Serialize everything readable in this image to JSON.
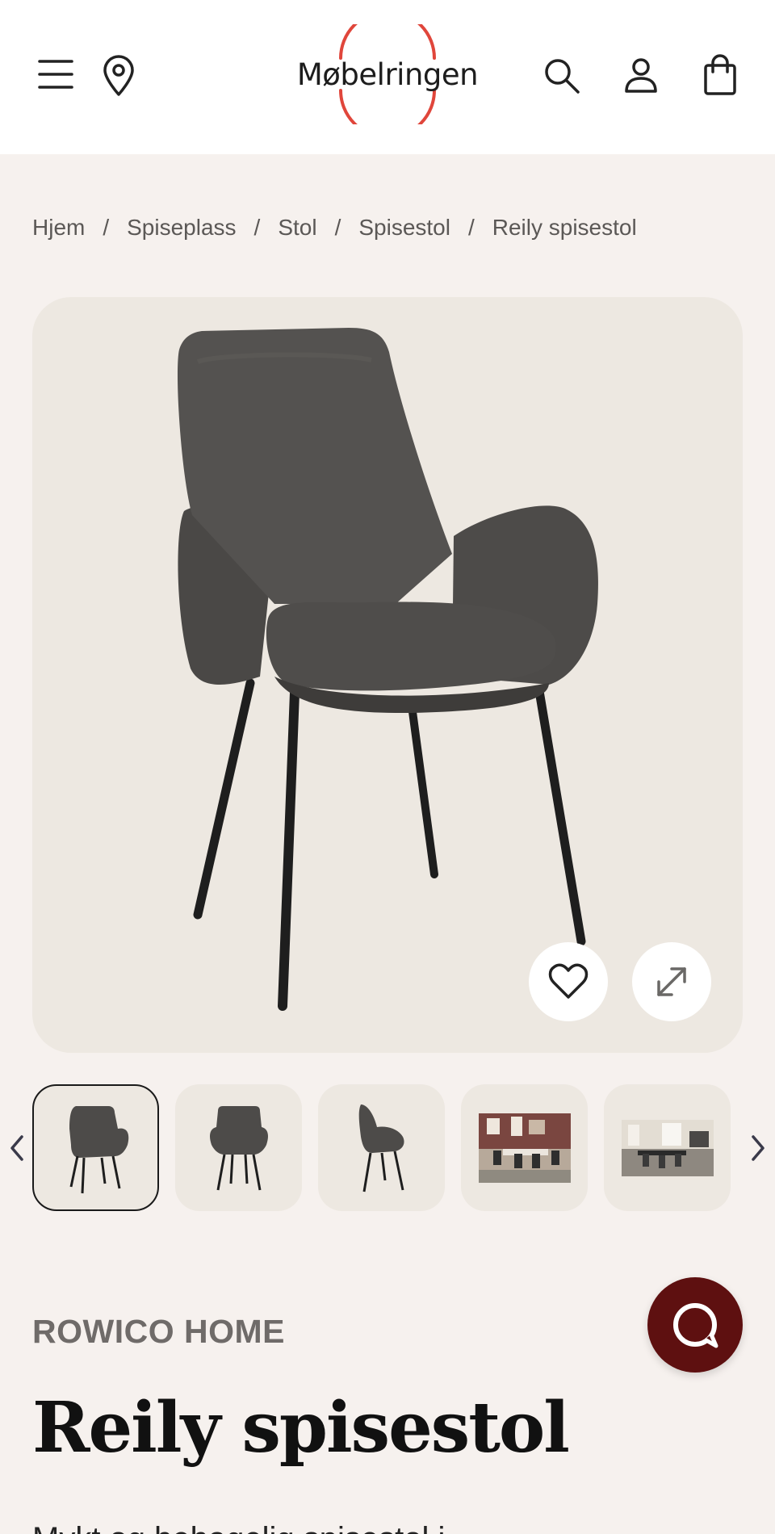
{
  "header": {
    "logo_text": "Møbelringen",
    "icons": [
      "menu-icon",
      "location-pin-icon",
      "search-icon",
      "user-icon",
      "shopping-bag-icon"
    ]
  },
  "breadcrumb": [
    {
      "label": "Hjem"
    },
    {
      "label": "Spiseplass"
    },
    {
      "label": "Stol"
    },
    {
      "label": "Spisestol"
    },
    {
      "label": "Reily spisestol"
    }
  ],
  "breadcrumb_separator": "/",
  "gallery": {
    "thumbnail_count": 5,
    "active_index": 0
  },
  "product": {
    "brand": "ROWICO HOME",
    "title": "Reily spisestol",
    "description_partial": "Mykt og behagelig spisestol i"
  },
  "colors": {
    "background": "#f6f1ee",
    "image_bg": "#ede8e1",
    "logo_ring": "#e0463b",
    "chat_button": "#5e1010",
    "chair": "#4a4846"
  }
}
